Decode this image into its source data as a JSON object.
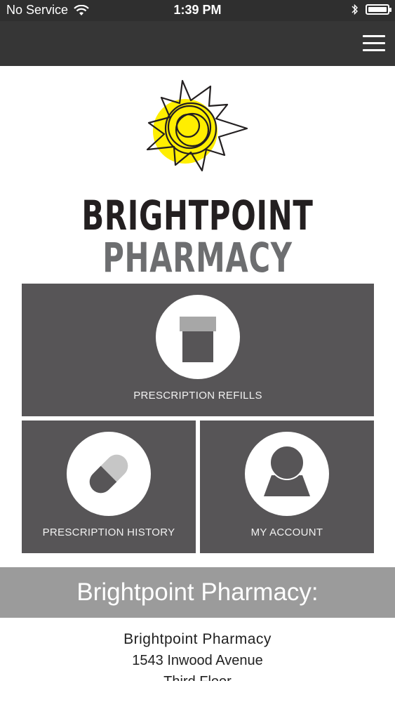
{
  "status_bar": {
    "carrier": "No Service",
    "time": "1:39 PM",
    "wifi_icon": "wifi-icon",
    "bluetooth_icon": "bluetooth-icon",
    "battery_icon": "battery-icon"
  },
  "nav": {
    "menu_icon": "hamburger-menu-icon"
  },
  "brand": {
    "logo_icon": "sun-logo-icon",
    "line1": "BRIGHTPOINT",
    "line2": "PHARMACY",
    "colors": {
      "sun": "#ffee00",
      "line1": "#231f20",
      "line2": "#6d6e70"
    }
  },
  "tiles": {
    "refills": {
      "label": "PRESCRIPTION REFILLS",
      "icon": "pill-bottle-icon"
    },
    "history": {
      "label": "PRESCRIPTION HISTORY",
      "icon": "capsule-icon"
    },
    "account": {
      "label": "MY ACCOUNT",
      "icon": "user-icon"
    },
    "tile_color": "#575557"
  },
  "info": {
    "header": "Brightpoint Pharmacy:",
    "name": "Brightpoint Pharmacy",
    "address1": "1543 Inwood Avenue",
    "address2": "Third Floor"
  }
}
